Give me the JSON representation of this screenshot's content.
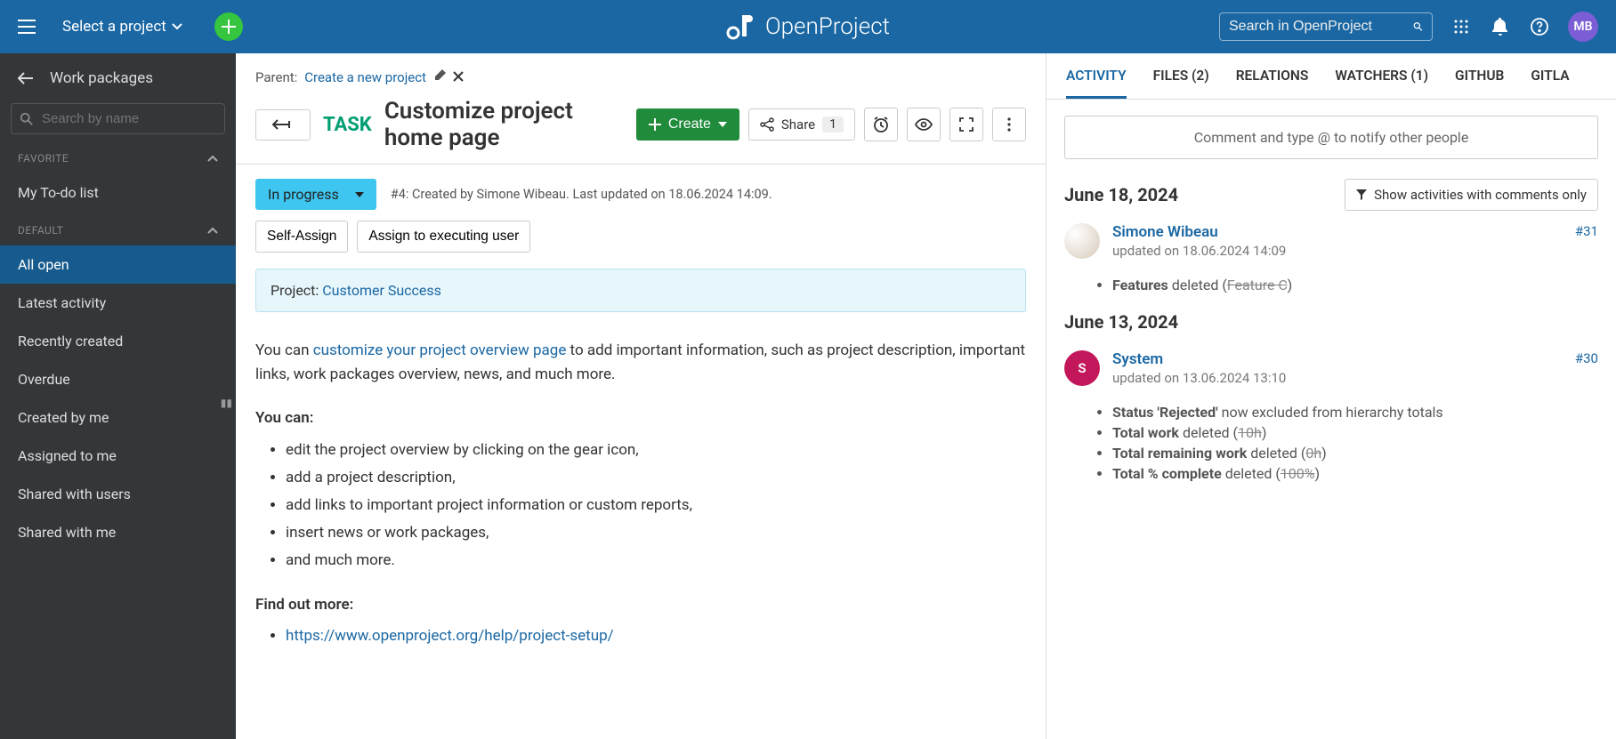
{
  "topbar": {
    "project_select": "Select a project",
    "search_placeholder": "Search in OpenProject",
    "brand": "OpenProject",
    "avatar_initials": "MB"
  },
  "sidebar": {
    "title": "Work packages",
    "search_placeholder": "Search by name",
    "groups": [
      {
        "label": "FAVORITE",
        "items": [
          "My To-do list"
        ]
      },
      {
        "label": "DEFAULT",
        "items": [
          "All open",
          "Latest activity",
          "Recently created",
          "Overdue",
          "Created by me",
          "Assigned to me",
          "Shared with users",
          "Shared with me"
        ]
      }
    ],
    "active_item": "All open"
  },
  "wp": {
    "parent_label": "Parent:",
    "parent_link": "Create a new project",
    "type": "TASK",
    "title": "Customize project home page",
    "create_label": "Create",
    "share_label": "Share",
    "share_count": "1",
    "status": "In progress",
    "meta": "#4: Created by Simone Wibeau. Last updated on 18.06.2024 14:09.",
    "self_assign": "Self-Assign",
    "assign_exec": "Assign to executing user",
    "project_prefix": "Project: ",
    "project_name": "Customer Success",
    "desc_intro_pre": "You can ",
    "desc_intro_link": "customize your project overview page",
    "desc_intro_post": " to add important information, such as project description, important links, work packages overview, news, and much more.",
    "you_can_label": "You can:",
    "you_can_items": [
      "edit the project overview by clicking on the gear icon,",
      "add a project description,",
      "add links to important project information or custom reports,",
      "insert news or work packages,",
      "and much more."
    ],
    "find_out_more": "Find out more:",
    "find_out_link": "https://www.openproject.org/help/project-setup/"
  },
  "right": {
    "tabs": [
      "ACTIVITY",
      "FILES (2)",
      "RELATIONS",
      "WATCHERS (1)",
      "GITHUB",
      "GITLA"
    ],
    "active_tab": "ACTIVITY",
    "comment_placeholder": "Comment and type @ to notify other people",
    "filter_label": "Show activities with comments only",
    "dates": [
      {
        "date": "June 18, 2024",
        "entries": [
          {
            "user": "Simone Wibeau",
            "avatar_type": "user",
            "initial": "",
            "meta": "updated on 18.06.2024 14:09",
            "num": "#31",
            "changes": [
              {
                "field": "Features",
                "text": " deleted (",
                "strike": "Feature C",
                "close": ")"
              }
            ]
          }
        ]
      },
      {
        "date": "June 13, 2024",
        "entries": [
          {
            "user": "System",
            "avatar_type": "system",
            "initial": "S",
            "meta": "updated on 13.06.2024 13:10",
            "num": "#30",
            "changes": [
              {
                "field": "Status 'Rejected'",
                "text": " now excluded from hierarchy totals",
                "strike": "",
                "close": ""
              },
              {
                "field": "Total work",
                "text": " deleted (",
                "strike": "10h",
                "close": ")"
              },
              {
                "field": "Total remaining work",
                "text": " deleted (",
                "strike": "0h",
                "close": ")"
              },
              {
                "field": "Total % complete",
                "text": " deleted (",
                "strike": "100%",
                "close": ")"
              }
            ]
          }
        ]
      }
    ]
  }
}
